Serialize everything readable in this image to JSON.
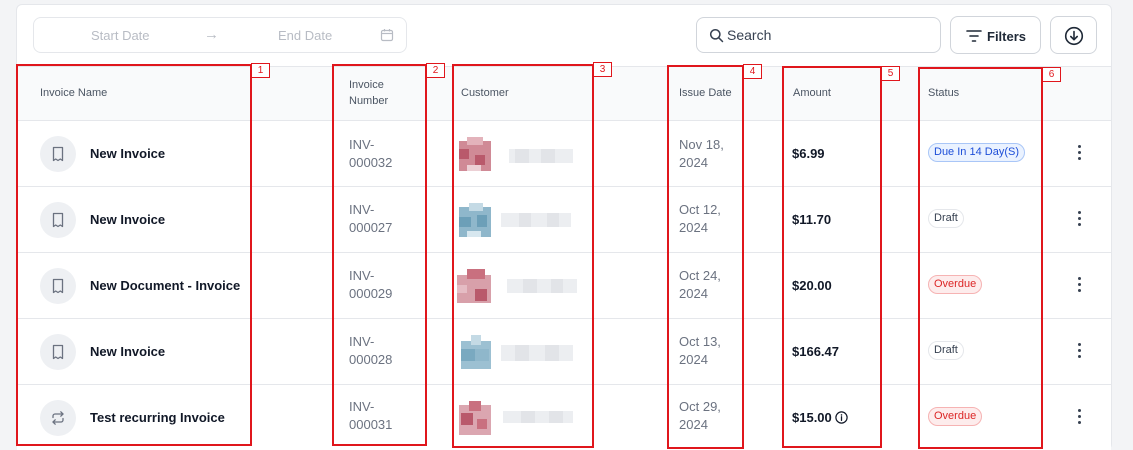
{
  "toolbar": {
    "start_date_placeholder": "Start Date",
    "end_date_placeholder": "End Date",
    "arrow": "→",
    "search_placeholder": "Search",
    "filters_label": "Filters"
  },
  "table": {
    "headers": {
      "invoice_name": "Invoice Name",
      "invoice_number_line1": "Invoice",
      "invoice_number_line2": "Number",
      "customer": "Customer",
      "issue_date": "Issue Date",
      "amount": "Amount",
      "status": "Status"
    },
    "rows": [
      {
        "name": "New Invoice",
        "icon": "receipt-icon",
        "number_prefix": "INV-",
        "number_suffix": "000032",
        "date_line1": "Nov 18,",
        "date_line2": "2024",
        "amount": "$6.99",
        "status": "Due In 14 Day(S)",
        "status_color": "blue",
        "customer_avatar": "pink"
      },
      {
        "name": "New Invoice",
        "icon": "receipt-icon",
        "number_prefix": "INV-",
        "number_suffix": "000027",
        "date_line1": "Oct 12,",
        "date_line2": "2024",
        "amount": "$11.70",
        "status": "Draft",
        "status_color": "gray",
        "customer_avatar": "blue"
      },
      {
        "name": "New Document - Invoice",
        "icon": "receipt-icon",
        "number_prefix": "INV-",
        "number_suffix": "000029",
        "date_line1": "Oct 24,",
        "date_line2": "2024",
        "amount": "$20.00",
        "status": "Overdue",
        "status_color": "red",
        "customer_avatar": "pink"
      },
      {
        "name": "New Invoice",
        "icon": "receipt-icon",
        "number_prefix": "INV-",
        "number_suffix": "000028",
        "date_line1": "Oct 13,",
        "date_line2": "2024",
        "amount": "$166.47",
        "status": "Draft",
        "status_color": "gray",
        "customer_avatar": "blue"
      },
      {
        "name": "Test recurring Invoice",
        "icon": "recurring-icon",
        "number_prefix": "INV-",
        "number_suffix": "000031",
        "date_line1": "Oct 29,",
        "date_line2": "2024",
        "amount": "$15.00",
        "status": "Overdue",
        "status_color": "red",
        "customer_avatar": "pink",
        "amount_info_icon": "info-icon"
      }
    ]
  },
  "annotations": {
    "labels": [
      "1",
      "2",
      "3",
      "4",
      "5",
      "6"
    ],
    "color": "#e0161c"
  },
  "colors": {
    "status_blue": "#1d4ed8",
    "status_red": "#dc2626",
    "avatar_pink": "#c9707f",
    "avatar_blue": "#6c9fb8"
  }
}
